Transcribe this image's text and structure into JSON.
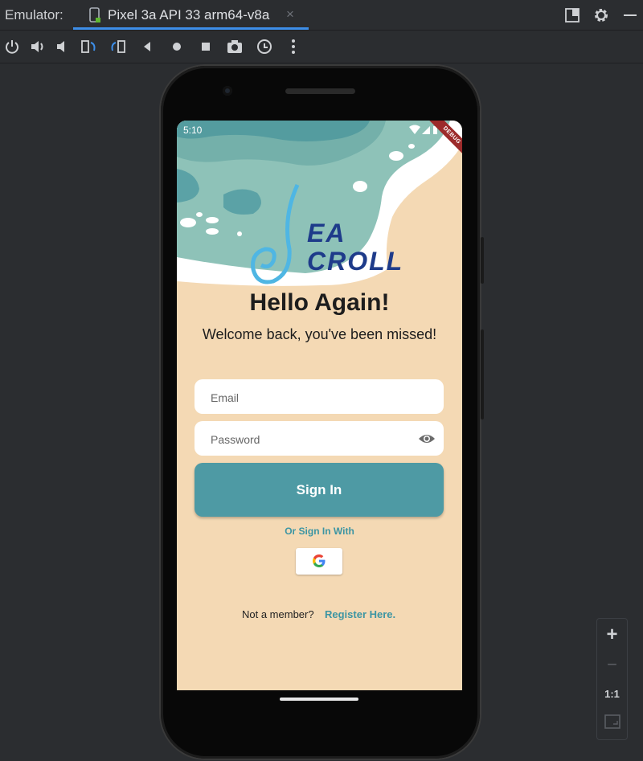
{
  "ide": {
    "label": "Emulator:",
    "tab_title": "Pixel 3a API 33 arm64-v8a",
    "tab_close": "×",
    "accent": "#3d8ee8"
  },
  "toolbar": {
    "tools": [
      "power-icon",
      "volume-up-icon",
      "volume-down-icon",
      "rotate-left-icon",
      "rotate-right-icon",
      "back-icon",
      "home-icon",
      "overview-icon",
      "camera-icon",
      "snapshot-icon",
      "more-icon"
    ]
  },
  "device": {
    "status_time": "5:10",
    "debug_label": "DEBUG",
    "logo_line1": "EA",
    "logo_line2": "CROLL",
    "heading": "Hello Again!",
    "subheading": "Welcome back, you've been missed!",
    "email_placeholder": "Email",
    "password_placeholder": "Password",
    "signin_label": "Sign In",
    "or_signin_label": "Or Sign In With",
    "not_member": "Not a member?",
    "register_label": "Register Here.",
    "colors": {
      "primary": "#4e9aa4",
      "sand": "#f4d9b4",
      "link": "#3c95a3",
      "logo": "#1e3b8a"
    }
  },
  "zoom": {
    "plus": "+",
    "minus": "−",
    "one_to_one": "1:1"
  }
}
